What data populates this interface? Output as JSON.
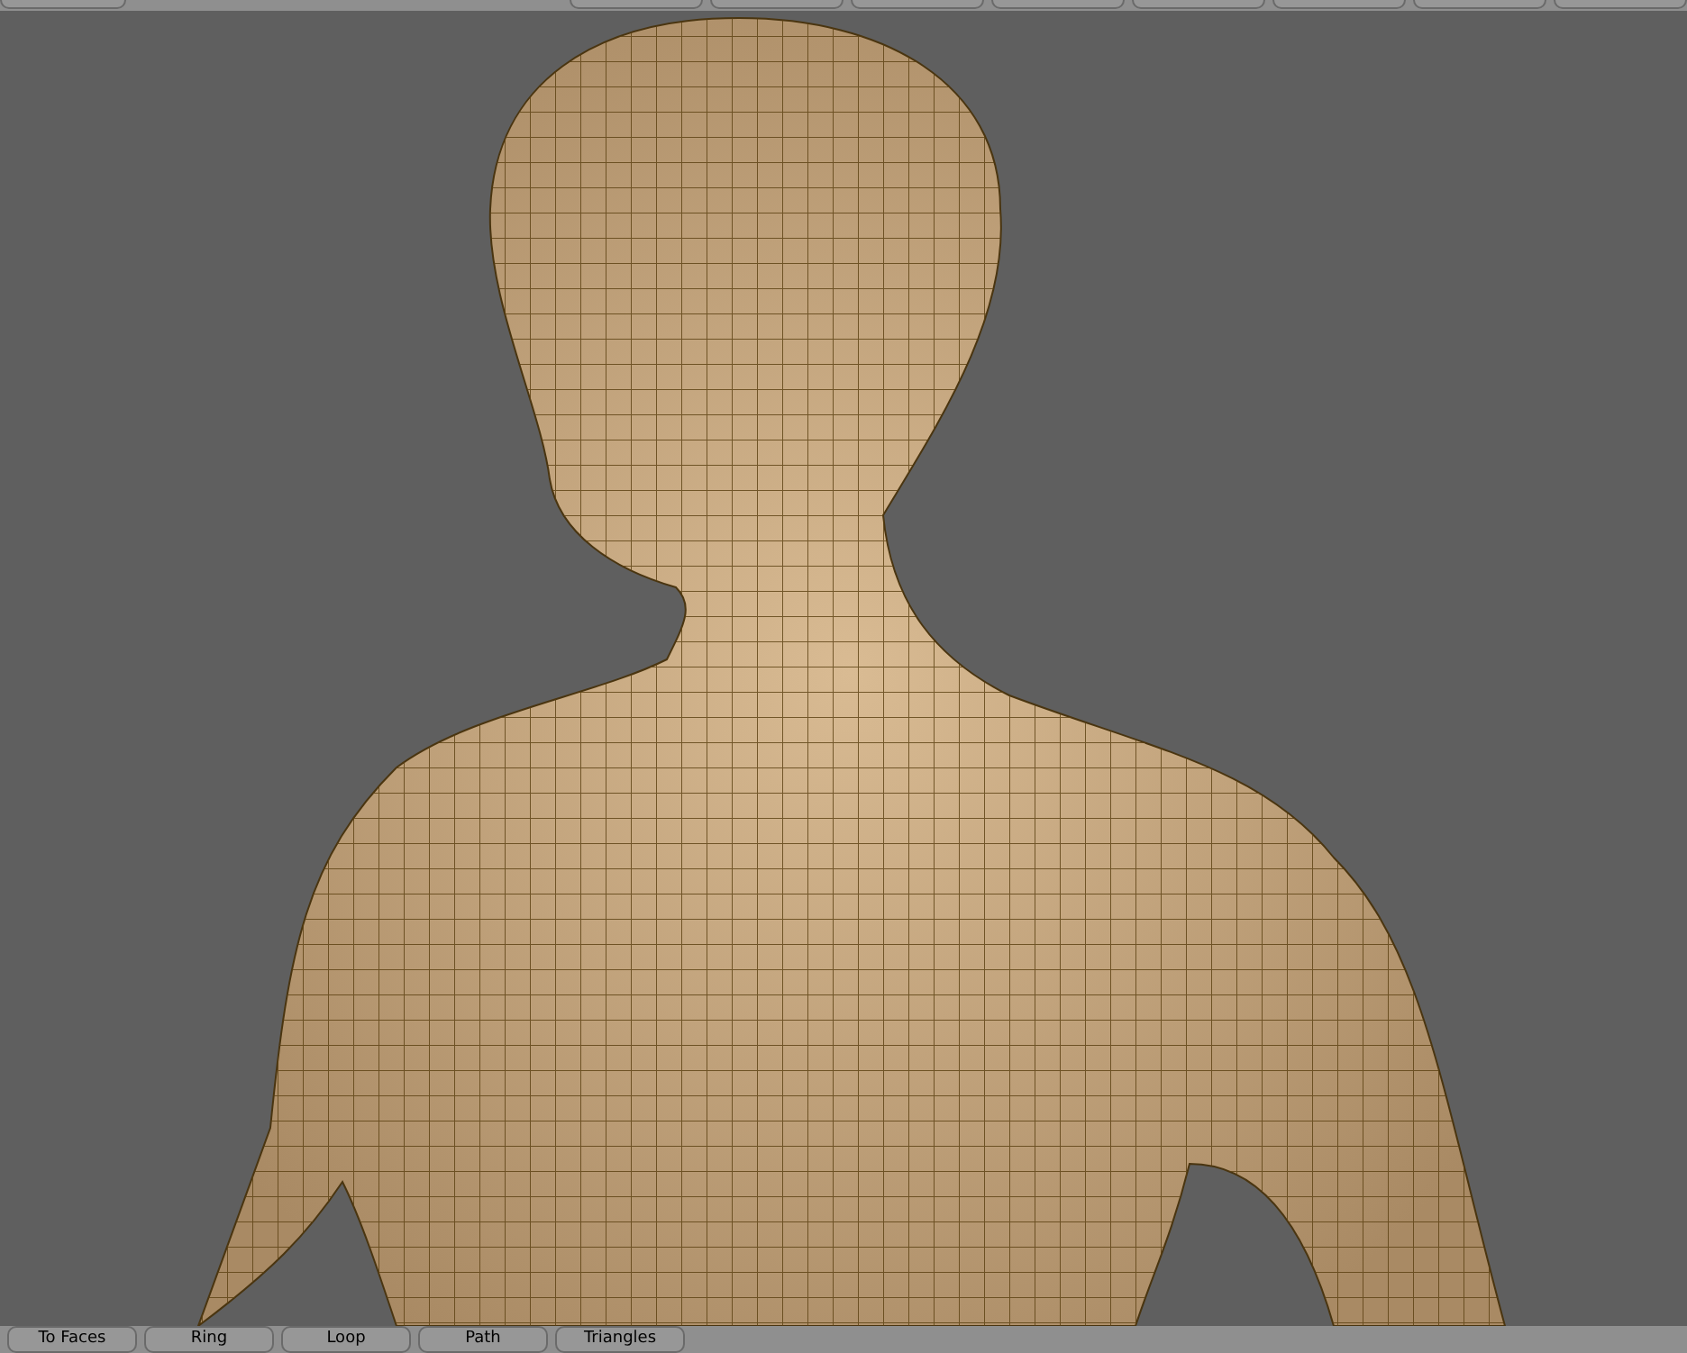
{
  "bottom_toolbar": {
    "buttons": [
      {
        "label": "To Faces"
      },
      {
        "label": "Ring"
      },
      {
        "label": "Loop"
      },
      {
        "label": "Path"
      },
      {
        "label": "Triangles"
      }
    ]
  }
}
